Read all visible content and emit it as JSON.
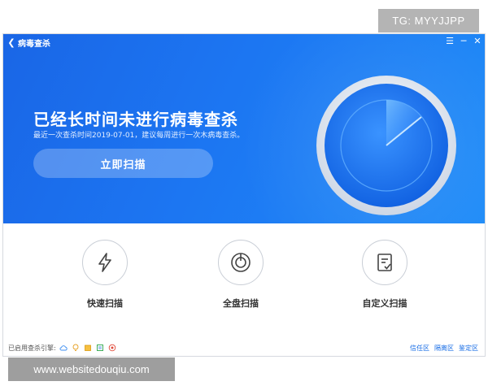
{
  "window": {
    "title": "病毒查杀"
  },
  "hero": {
    "headline": "已经长时间未进行病毒查杀",
    "subtitle": "最近一次查杀时间2019-07-01，建议每周进行一次木病毒查杀。",
    "scan_button": "立即扫描"
  },
  "features": [
    {
      "label": "快速扫描",
      "icon": "lightning-icon"
    },
    {
      "label": "全盘扫描",
      "icon": "disk-icon"
    },
    {
      "label": "自定义扫描",
      "icon": "checklist-icon"
    }
  ],
  "footer": {
    "engines_label": "已启用查杀引擎:",
    "engine_icons": [
      "cloud-icon",
      "bulb-icon",
      "box-icon",
      "shield-icon",
      "badge-icon"
    ],
    "links": [
      "信任区",
      "隔离区",
      "鉴定区"
    ]
  },
  "watermarks": {
    "top": "TG: MYYJJPP",
    "bottom": "www.websitedouqiu.com"
  },
  "colors": {
    "hero_start": "#1a66e6",
    "hero_end": "#1f8cf8",
    "link": "#1b6fe6"
  }
}
